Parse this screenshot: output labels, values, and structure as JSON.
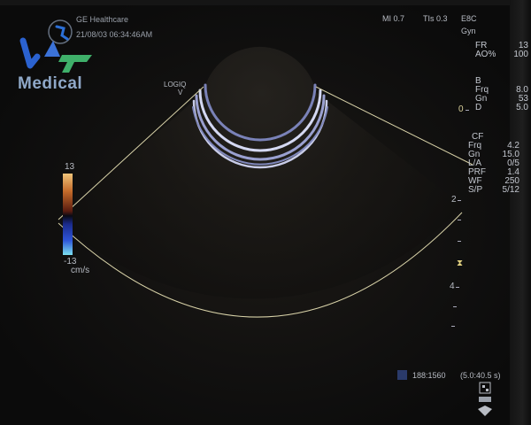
{
  "header": {
    "manufacturer": "GE Healthcare",
    "datetime": "21/08/03 06:34:46AM",
    "mi": "MI 0.7",
    "tis": "TIs 0.3",
    "probe": "E8C",
    "preset": "Gyn"
  },
  "watermark": {
    "brand_text": "Medical"
  },
  "image_label": {
    "system_line1": "LOGIQ",
    "system_line2": "V"
  },
  "params_general": [
    {
      "label": "FR",
      "value": "13"
    },
    {
      "label": "AO%",
      "value": "100"
    }
  ],
  "params_b_mode": {
    "title": "B",
    "rows": [
      {
        "label": "Frq",
        "value": "8.0"
      },
      {
        "label": "Gn",
        "value": "53"
      },
      {
        "label": "D",
        "value": "5.0"
      }
    ]
  },
  "params_cf": {
    "title": "CF",
    "rows": [
      {
        "label": "Frq",
        "value": "4.2"
      },
      {
        "label": "Gn",
        "value": "15.0"
      },
      {
        "label": "L/A",
        "value": "0/5"
      },
      {
        "label": "PRF",
        "value": "1.4"
      },
      {
        "label": "WF",
        "value": "250"
      },
      {
        "label": "S/P",
        "value": "5/12"
      }
    ]
  },
  "depth_scale": {
    "mark_0": "0",
    "mark_2": "2",
    "mark_4": "4",
    "focus_marker": "⧗"
  },
  "color_scale": {
    "top_value": "13",
    "bottom_value": "-13",
    "unit": "cm/s"
  },
  "footer": {
    "frame_counter": "188:1560",
    "cine_time": "(5.0:40.5 s)"
  },
  "colors": {
    "text": "#c3c7cf",
    "sector_line": "#d8d2a8"
  }
}
